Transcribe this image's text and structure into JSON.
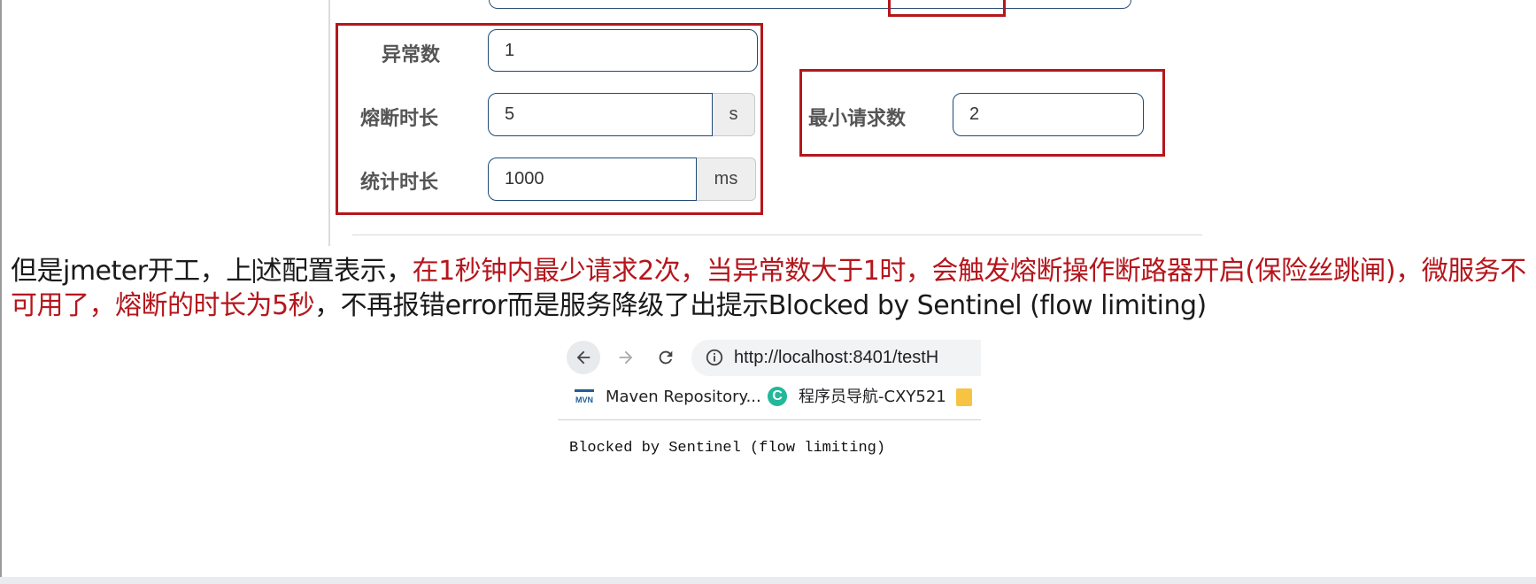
{
  "form": {
    "exception_count": {
      "label": "异常数",
      "value": "1"
    },
    "break_duration": {
      "label": "熔断时长",
      "value": "5",
      "unit": "s"
    },
    "stat_duration": {
      "label": "统计时长",
      "value": "1000",
      "unit": "ms"
    },
    "min_request": {
      "label": "最小请求数",
      "value": "2"
    }
  },
  "annotation": {
    "part1": "但是jmeter开工，上",
    "part2": "述配置表示，",
    "part3_red": "在1秒钟内最少请求2次，当异常数大于1时，会触发熔断操作断路器开启(保险丝跳闸)，微服务不可用了，熔断的时长为5秒",
    "part4": "，不再报错error而是服务降级了出提示Blocked by Sentinel (flow limiting)"
  },
  "browser": {
    "url": "http://localhost:8401/testH",
    "bookmarks": [
      {
        "label": "Maven Repository...",
        "icon": "maven-icon"
      },
      {
        "label": "程序员导航-CXY521",
        "icon": "c-logo-icon"
      },
      {
        "label": "",
        "icon": "folder-icon"
      }
    ],
    "c_icon_letter": "C",
    "mvn_icon_text": "MVN",
    "page_text": "Blocked by Sentinel (flow limiting)"
  },
  "colors": {
    "highlight_red": "#b5161c",
    "input_border": "#1f4a75",
    "label_gray": "#555555"
  }
}
